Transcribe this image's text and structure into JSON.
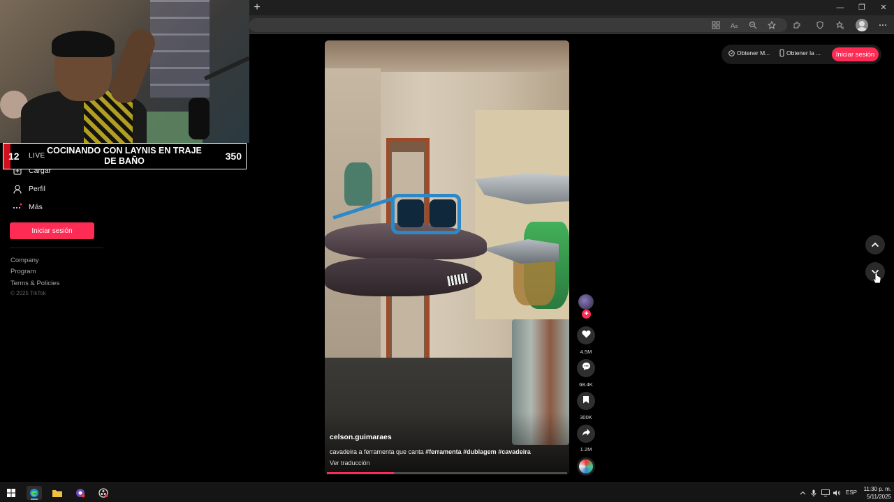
{
  "browser": {
    "new_tab_glyph": "+",
    "window_controls": {
      "minimize": "—",
      "restore": "❐",
      "close": "✕"
    },
    "toolbar_icons": [
      "apps-icon",
      "read-aloud-icon",
      "zoom-out-icon",
      "favorite-star-icon",
      "extensions-icon",
      "browser-essentials-icon",
      "favorites-icon",
      "profile-avatar",
      "more-options-icon"
    ]
  },
  "stream_overlay": {
    "viewer_badge": "12",
    "live_label": "LIVE",
    "title": "COCINANDO CON LAYNIS EN TRAJE DE BAÑO",
    "count": "350"
  },
  "sidebar": {
    "items": [
      {
        "label": "Cargar",
        "icon": "upload-icon"
      },
      {
        "label": "Perfil",
        "icon": "profile-icon"
      },
      {
        "label": "Más",
        "icon": "more-dots-icon"
      }
    ],
    "login_button": "Iniciar sesión",
    "footer_links": [
      "Company",
      "Program",
      "Terms & Policies"
    ],
    "copyright": "© 2025 TikTok"
  },
  "video": {
    "username": "celson.guimaraes",
    "caption_text": "cavadeira a ferramenta que canta",
    "hashtags": [
      "#ferramenta",
      "#dublagem",
      "#cavadeira"
    ],
    "translate_link": "Ver traducción",
    "progress": 0.28
  },
  "actions": {
    "likes": "4.5M",
    "comments": "68.4K",
    "saves": "300K",
    "shares": "1.2M"
  },
  "top_right": {
    "get_app": "Obtener M...",
    "get_desktop": "Obtener la ...",
    "login_button": "Iniciar sesión"
  },
  "taskbar": {
    "language": "ESP",
    "time": "11:30 p. m.",
    "date": "5/11/2025"
  },
  "colors": {
    "accent": "#fe2c55",
    "banner_red": "#d0101c"
  }
}
